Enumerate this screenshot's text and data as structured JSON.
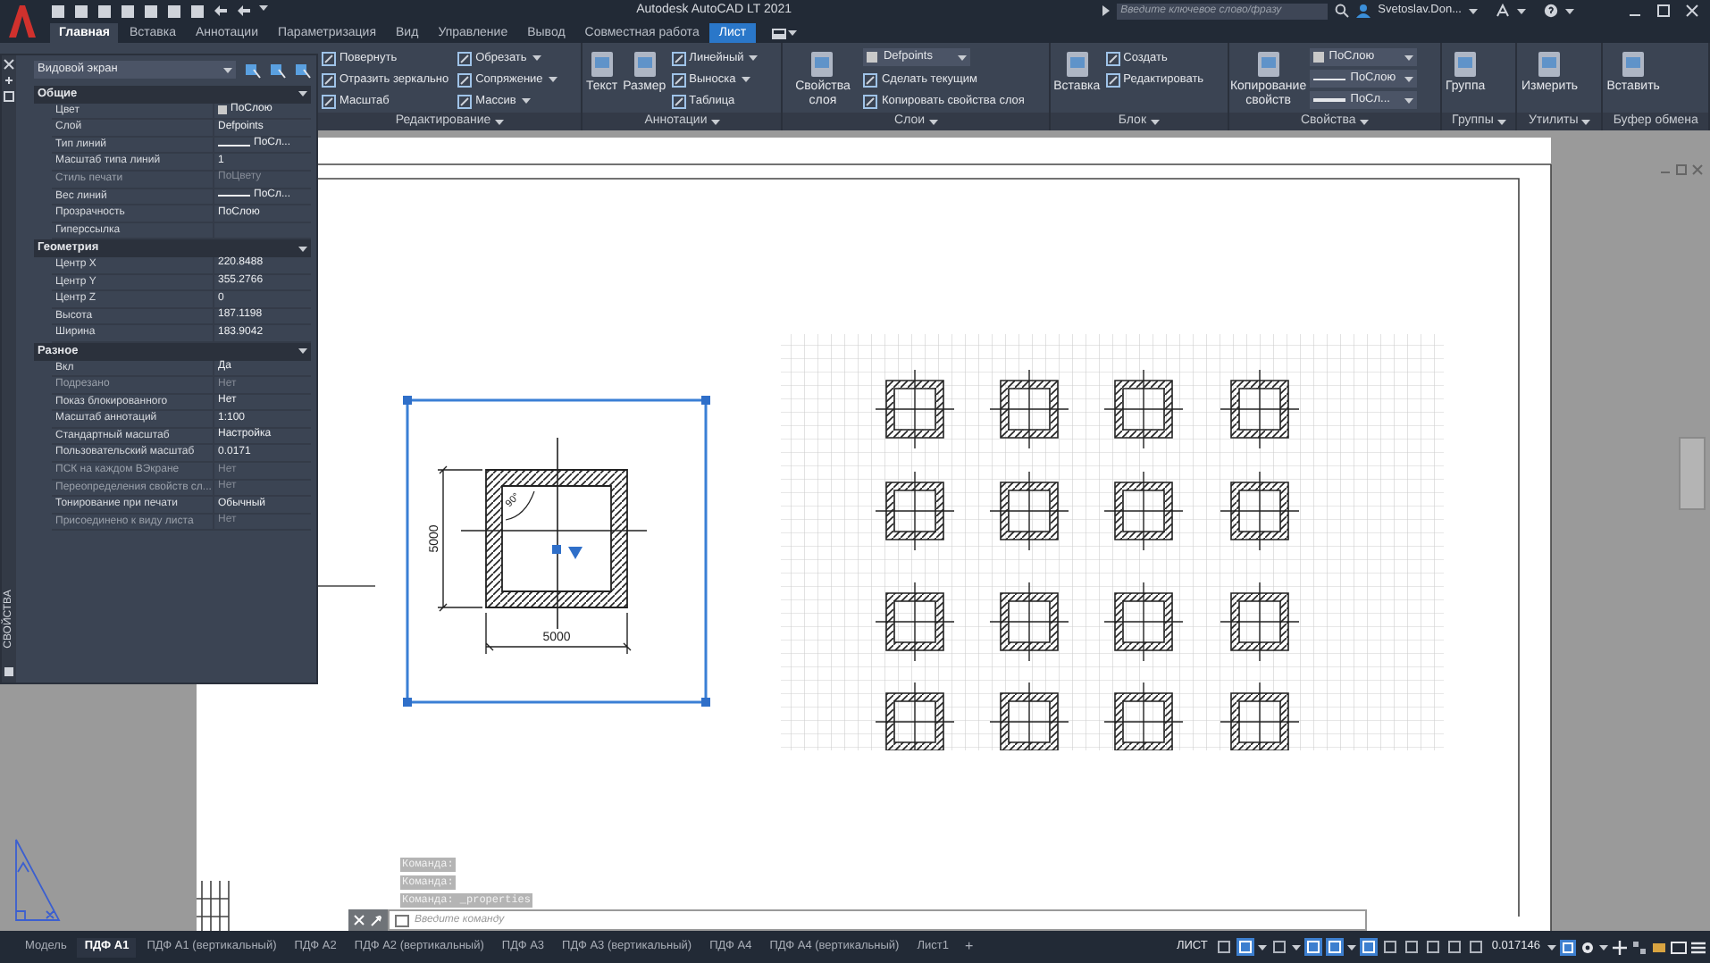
{
  "title_bar": {
    "title": "Autodesk AutoCAD LT 2021",
    "search": {
      "placeholder": "Введите ключевое слово/фразу"
    },
    "user": "Svetoslav.Don..."
  },
  "ribbon_tabs": [
    {
      "label": "Главная",
      "selected": true,
      "contextual": false
    },
    {
      "label": "Вставка",
      "selected": false,
      "contextual": false
    },
    {
      "label": "Аннотации",
      "selected": false,
      "contextual": false
    },
    {
      "label": "Параметризация",
      "selected": false,
      "contextual": false
    },
    {
      "label": "Вид",
      "selected": false,
      "contextual": false
    },
    {
      "label": "Управление",
      "selected": false,
      "contextual": false
    },
    {
      "label": "Вывод",
      "selected": false,
      "contextual": false
    },
    {
      "label": "Совместная работа",
      "selected": false,
      "contextual": false
    },
    {
      "label": "Лист",
      "selected": false,
      "contextual": true
    }
  ],
  "ribbon_panels": [
    {
      "title": "Редактирование",
      "menu": true,
      "small": [
        {
          "label": "Повернуть",
          "dropdown": false
        },
        {
          "label": "Отразить зеркально",
          "dropdown": false
        },
        {
          "label": "Масштаб",
          "dropdown": false
        },
        {
          "label": "Обрезать",
          "dropdown": true
        },
        {
          "label": "Сопряжение",
          "dropdown": true
        },
        {
          "label": "Массив",
          "dropdown": true
        }
      ]
    },
    {
      "title": "Аннотации",
      "menu": true,
      "large": [
        {
          "label": "Текст"
        },
        {
          "label": "Размер"
        }
      ],
      "small": [
        {
          "label": "Линейный",
          "dropdown": true
        },
        {
          "label": "Выноска",
          "dropdown": true
        },
        {
          "label": "Таблица",
          "dropdown": false
        }
      ]
    },
    {
      "title": "Слои",
      "menu": true,
      "large": [
        {
          "label": "Свойства слоя"
        }
      ],
      "dropdowns": [
        {
          "kind": "layer",
          "value": "Defpoints"
        }
      ],
      "small": [
        {
          "label": "Сделать текущим",
          "dropdown": false
        },
        {
          "label": "Копировать свойства слоя",
          "dropdown": false
        }
      ]
    },
    {
      "title": "Блок",
      "menu": true,
      "large": [
        {
          "label": "Вставка"
        }
      ],
      "small": [
        {
          "label": "Создать",
          "dropdown": false
        },
        {
          "label": "Редактировать",
          "dropdown": false
        }
      ]
    },
    {
      "title": "Свойства",
      "menu": true,
      "large": [
        {
          "label": "Копирование свойств"
        }
      ],
      "dropdowns": [
        {
          "kind": "color",
          "value": "ПоСлою"
        },
        {
          "kind": "linetype",
          "value": "ПоСлою"
        },
        {
          "kind": "lineweight",
          "value": "ПоСл..."
        }
      ]
    },
    {
      "title": "Группы",
      "menu": true,
      "large": [
        {
          "label": "Группа"
        }
      ]
    },
    {
      "title": "Утилиты",
      "menu": true,
      "large": [
        {
          "label": "Измерить"
        }
      ]
    },
    {
      "title": "Буфер обмена",
      "menu": false,
      "large": [
        {
          "label": "Вставить"
        }
      ]
    }
  ],
  "properties_palette": {
    "title": "СВОЙСТВА",
    "object": "Видовой экран",
    "sections": [
      {
        "title": "Общие",
        "expanded": true,
        "rows": [
          {
            "label": "Цвет",
            "value": "ПоСлою",
            "kind": "color",
            "disabled": false
          },
          {
            "label": "Слой",
            "value": "Defpoints",
            "kind": "text",
            "disabled": false
          },
          {
            "label": "Тип линий",
            "value": "ПоСл...",
            "kind": "linetype",
            "disabled": false
          },
          {
            "label": "Масштаб типа линий",
            "value": "1",
            "kind": "text",
            "disabled": false
          },
          {
            "label": "Стиль печати",
            "value": "ПоЦвету",
            "kind": "text",
            "disabled": true
          },
          {
            "label": "Вес линий",
            "value": "ПоСл...",
            "kind": "linetype",
            "disabled": false
          },
          {
            "label": "Прозрачность",
            "value": "ПоСлою",
            "kind": "text",
            "disabled": false
          },
          {
            "label": "Гиперссылка",
            "kind": "text",
            "disabled": false
          }
        ]
      },
      {
        "title": "Геометрия",
        "expanded": true,
        "rows": [
          {
            "label": "Центр X",
            "value": "220.8488",
            "kind": "text",
            "disabled": false
          },
          {
            "label": "Центр Y",
            "value": "355.2766",
            "kind": "text",
            "disabled": false
          },
          {
            "label": "Центр Z",
            "value": "0",
            "kind": "text",
            "disabled": false
          },
          {
            "label": "Высота",
            "value": "187.1198",
            "kind": "text",
            "disabled": false
          },
          {
            "label": "Ширина",
            "value": "183.9042",
            "kind": "text",
            "disabled": false
          }
        ]
      },
      {
        "title": "Разное",
        "expanded": true,
        "rows": [
          {
            "label": "Вкл",
            "value": "Да",
            "kind": "text",
            "disabled": false
          },
          {
            "label": "Подрезано",
            "value": "Нет",
            "kind": "text",
            "disabled": true
          },
          {
            "label": "Показ блокированного",
            "value": "Нет",
            "kind": "text",
            "disabled": false
          },
          {
            "label": "Масштаб аннотаций",
            "value": "1:100",
            "kind": "text",
            "disabled": false
          },
          {
            "label": "Стандартный масштаб",
            "value": "Настройка",
            "kind": "text",
            "disabled": false
          },
          {
            "label": "Пользовательский масштаб",
            "value": "0.0171",
            "kind": "text",
            "disabled": false
          },
          {
            "label": "ПСК на каждом ВЭкране",
            "value": "Нет",
            "kind": "text",
            "disabled": true
          },
          {
            "label": "Переопределения свойств сл...",
            "value": "Нет",
            "kind": "text",
            "disabled": true
          },
          {
            "label": "Тонирование при печати",
            "value": "Обычный",
            "kind": "text",
            "disabled": false
          },
          {
            "label": "Присоединено к виду листа",
            "value": "Нет",
            "kind": "text",
            "disabled": true
          }
        ]
      }
    ]
  },
  "viewports": [
    {
      "kind": "detail",
      "selected": true,
      "dim_horizontal": "5000",
      "dim_vertical": "5000",
      "angle": "90°"
    },
    {
      "kind": "plan",
      "selected": false
    }
  ],
  "command_history": [
    "Команда:",
    "Команда:",
    "Команда: _properties"
  ],
  "command_input": {
    "placeholder": "Введите команду"
  },
  "layout_tabs": [
    {
      "label": "Модель",
      "selected": false
    },
    {
      "label": "ПДФ A1",
      "selected": true
    },
    {
      "label": "ПДФ A1 (вертикальный)",
      "selected": false
    },
    {
      "label": "ПДФ A2",
      "selected": false
    },
    {
      "label": "ПДФ A2 (вертикальный)",
      "selected": false
    },
    {
      "label": "ПДФ A3",
      "selected": false
    },
    {
      "label": "ПДФ A3 (вертикальный)",
      "selected": false
    },
    {
      "label": "ПДФ A4",
      "selected": false
    },
    {
      "label": "ПДФ A4 (вертикальный)",
      "selected": false
    },
    {
      "label": "Лист1",
      "selected": false
    }
  ],
  "new_tab": "+",
  "status_bar": {
    "space": "ЛИСТ",
    "scale": "0.017146",
    "toggles": [
      {
        "on": false
      },
      {
        "on": true
      },
      {
        "on": false
      },
      {
        "on": true
      },
      {
        "on": true
      },
      {
        "on": true
      },
      {
        "on": false
      },
      {
        "on": false
      },
      {
        "on": false
      },
      {
        "on": false
      },
      {
        "on": false
      }
    ]
  }
}
